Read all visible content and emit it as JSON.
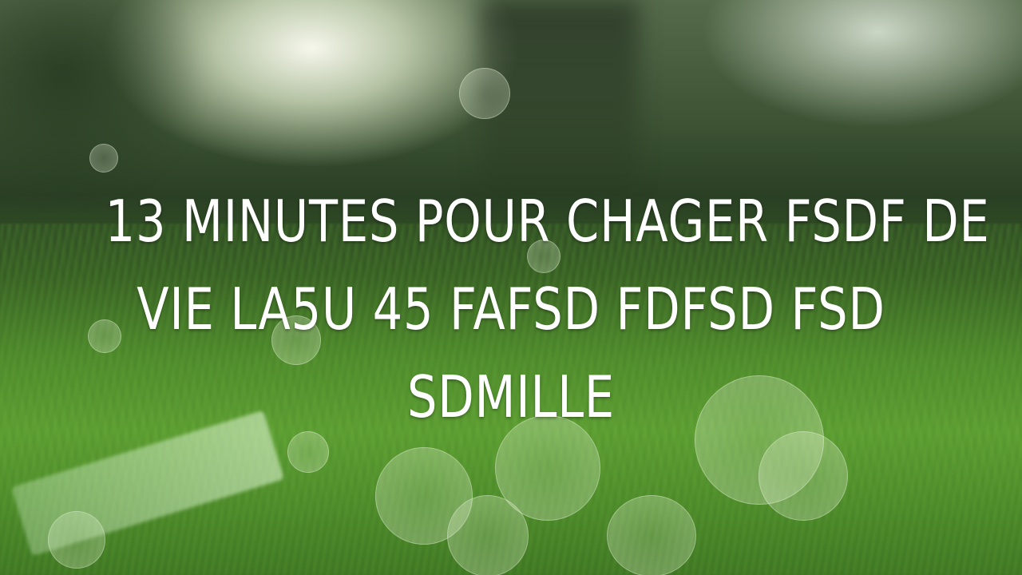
{
  "caption": {
    "lines": [
      "13 MINUTES POUR CHAGER FSDF  DE",
      "VIE LA5U 45 FAFSD FDFSD FSD",
      "SDMILLE"
    ]
  },
  "background": {
    "subject": "grass-bokeh-sunlight",
    "colors": {
      "sky": "#e8efd8",
      "trees": "#2a3f24",
      "grass": "#5fa033",
      "text": "#ffffff"
    }
  }
}
